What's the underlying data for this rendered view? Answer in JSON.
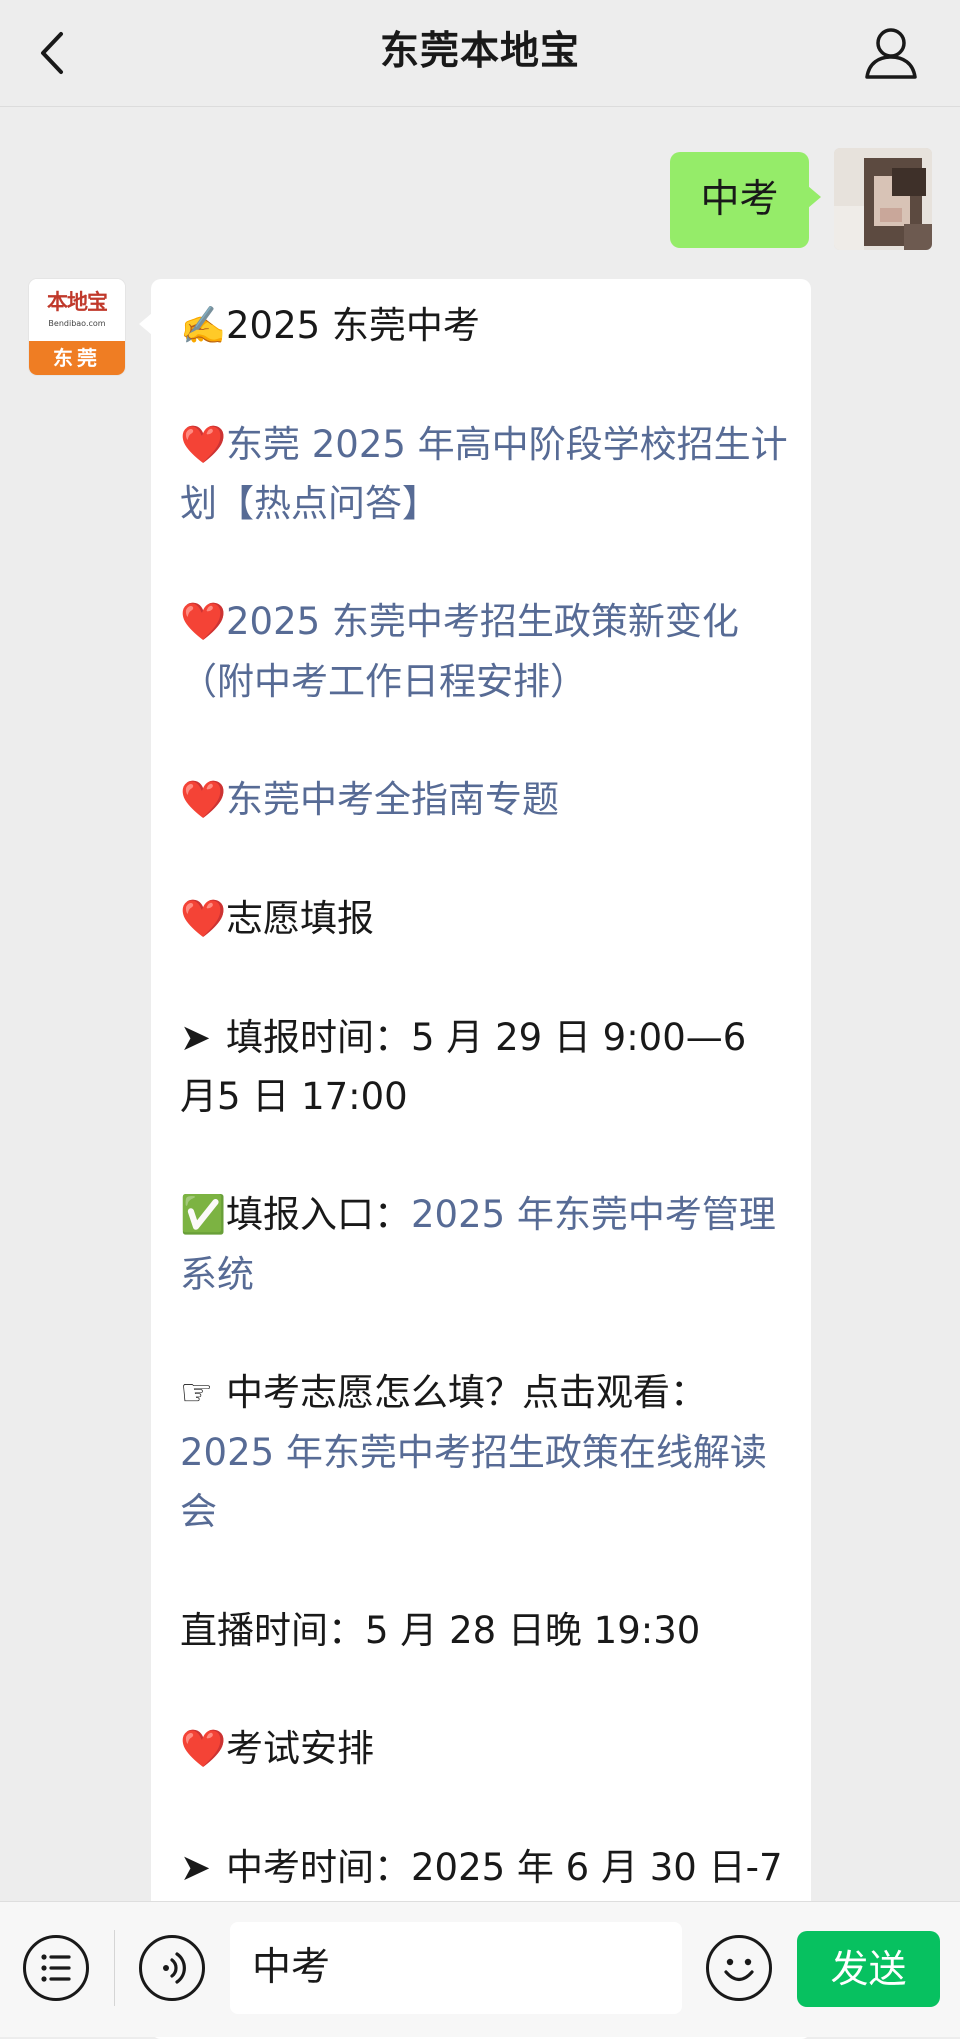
{
  "header": {
    "title": "东莞本地宝",
    "back_icon": "chevron-left-icon",
    "profile_icon": "person-icon"
  },
  "chat": {
    "outgoing": {
      "text": "中考"
    },
    "bot_avatar": {
      "brand": "本地宝",
      "url": "Bendibao.com",
      "city": "东莞"
    },
    "reply": {
      "items": [
        {
          "emoji": "✍️",
          "text": "2025 东莞中考",
          "link": ""
        },
        {
          "emoji": "❤️",
          "text": "",
          "link": "东莞 2025 年高中阶段学校招生计划【热点问答】"
        },
        {
          "emoji": "❤️",
          "text": "",
          "link": "2025 东莞中考招生政策新变化（附中考工作日程安排）"
        },
        {
          "emoji": "❤️",
          "text": "",
          "link": "东莞中考全指南专题"
        },
        {
          "emoji": "❤️",
          "text": "志愿填报",
          "link": ""
        },
        {
          "emoji": "➤",
          "text": "填报时间：5 月 29 日 9:00—6 月5 日 17:00",
          "link": ""
        },
        {
          "emoji": "✅",
          "text": "填报入口：",
          "link": "2025 年东莞中考管理系统"
        },
        {
          "emoji": "☞",
          "text": "中考志愿怎么填？点击观看：",
          "link": "2025 年东莞中考招生政策在线解读会"
        },
        {
          "emoji": "",
          "text": "直播时间：5 月 28 日晚 19:30",
          "link": ""
        },
        {
          "emoji": "❤️",
          "text": "考试安排",
          "link": ""
        },
        {
          "emoji": "➤",
          "text": "中考时间：2025 年 6 月 30 日-7",
          "link": ""
        }
      ]
    }
  },
  "composer": {
    "menu_icon": "list-menu-icon",
    "voice_icon": "voice-icon",
    "input_value": "中考",
    "emoji_icon": "smiley-icon",
    "send_label": "发送"
  },
  "colors": {
    "background": "#ededed",
    "outgoing_bubble": "#95ec69",
    "link": "#576b95",
    "send_button": "#07c160"
  }
}
